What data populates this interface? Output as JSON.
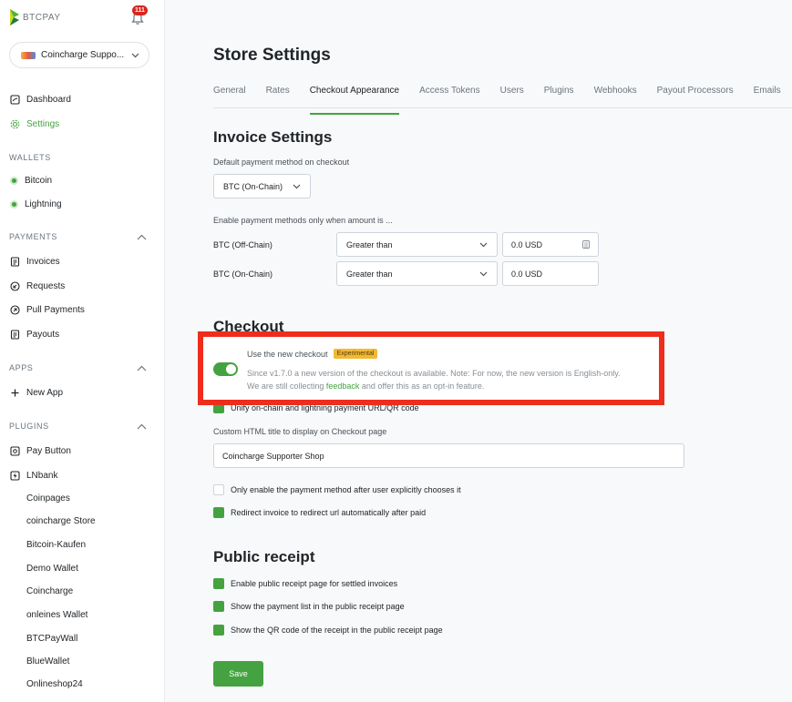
{
  "brand": {
    "name": "BTCPAY",
    "notifications": "111"
  },
  "store": {
    "name": "Coincharge Suppo..."
  },
  "nav": {
    "dashboard": "Dashboard",
    "settings": "Settings",
    "wallets_title": "WALLETS",
    "bitcoin": "Bitcoin",
    "lightning": "Lightning",
    "payments_title": "PAYMENTS",
    "invoices": "Invoices",
    "requests": "Requests",
    "pull_payments": "Pull Payments",
    "payouts": "Payouts",
    "apps_title": "APPS",
    "new_app": "New App",
    "plugins_title": "PLUGINS",
    "pay_button": "Pay Button",
    "lnbank": "LNbank",
    "plugin_items": [
      "Coinpages",
      "coincharge Store",
      "Bitcoin-Kaufen",
      "Demo Wallet",
      "Coincharge",
      "onleines Wallet",
      "BTCPayWall",
      "BlueWallet",
      "Onlineshop24"
    ]
  },
  "page": {
    "title": "Store Settings"
  },
  "tabs": [
    "General",
    "Rates",
    "Checkout Appearance",
    "Access Tokens",
    "Users",
    "Plugins",
    "Webhooks",
    "Payout Processors",
    "Emails"
  ],
  "invoice": {
    "title": "Invoice Settings",
    "default_method_label": "Default payment method on checkout",
    "default_method_value": "BTC (On-Chain)",
    "enable_label": "Enable payment methods only when amount is ...",
    "rows": [
      {
        "method": "BTC (Off-Chain)",
        "condition": "Greater than",
        "amount": "0.0 USD"
      },
      {
        "method": "BTC (On-Chain)",
        "condition": "Greater than",
        "amount": "0.0 USD"
      }
    ]
  },
  "checkout": {
    "title": "Checkout",
    "new_checkout_label": "Use the new checkout",
    "experimental": "Experimental",
    "desc_1": "Since v1.7.0 a new version of the checkout is available. Note: For now, the new version is English-only.",
    "desc_2_pre": "We are still collecting ",
    "desc_2_link": "feedback",
    "desc_2_post": " and offer this as an opt-in feature.",
    "unified_qr": "Unify on-chain and lightning payment URL/QR code",
    "custom_title_label": "Custom HTML title to display on Checkout page",
    "custom_title_value": "Coincharge Supporter Shop",
    "explicit_choice": "Only enable the payment method after user explicitly chooses it",
    "redirect": "Redirect invoice to redirect url automatically after paid"
  },
  "receipt": {
    "title": "Public receipt",
    "enable": "Enable public receipt page for settled invoices",
    "payment_list": "Show the payment list in the public receipt page",
    "qr_code": "Show the QR code of the receipt in the public receipt page"
  },
  "actions": {
    "save": "Save"
  },
  "colors": {
    "accent": "#44a340",
    "highlight": "#ee2d1c",
    "badge": "#f2b935"
  }
}
